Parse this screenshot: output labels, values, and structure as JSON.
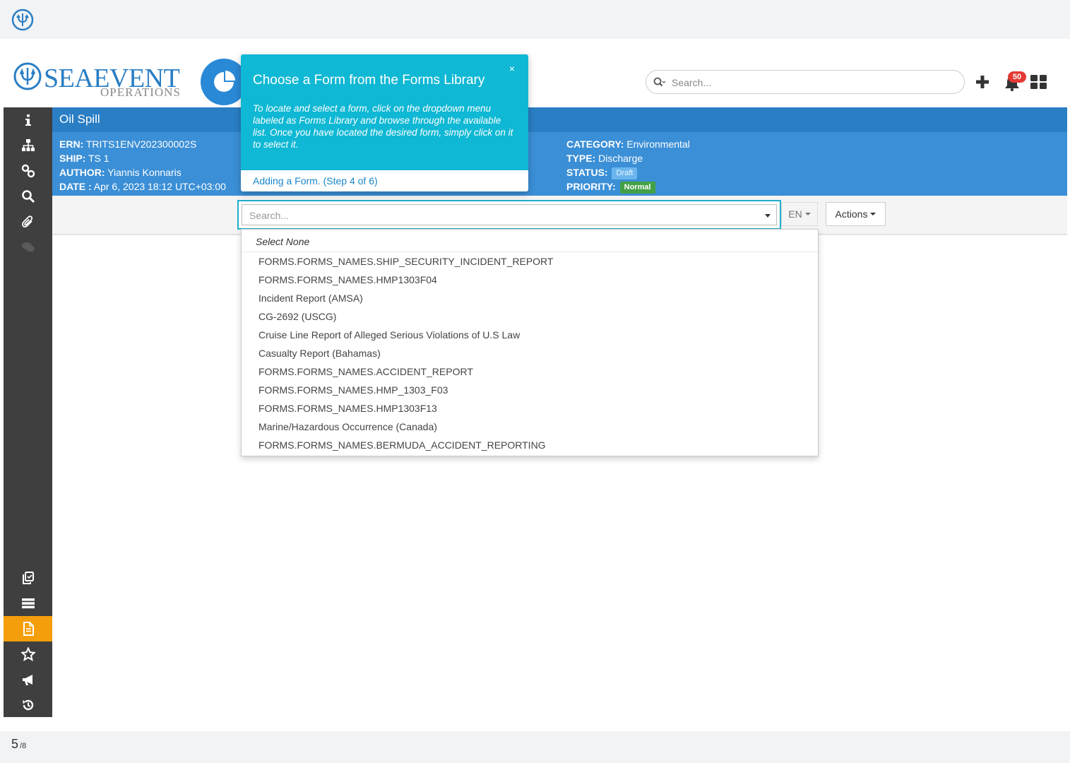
{
  "header": {
    "brand_name": "SEAEVENT",
    "brand_sub": "OPERATIONS",
    "search_placeholder": "Search...",
    "notifications_count": "50"
  },
  "incident": {
    "title": "Oil Spill",
    "ern_label": "ERN:",
    "ern": "TRITS1ENV202300002S",
    "ship_label": "SHIP:",
    "ship": "TS 1",
    "author_label": "AUTHOR:",
    "author": "Yiannis Konnaris",
    "date_label": "DATE :",
    "date": "Apr 6, 2023 18:12 UTC+03:00",
    "category_label": "CATEGORY:",
    "category": "Environmental",
    "type_label": "TYPE:",
    "type": "Discharge",
    "status_label": "STATUS:",
    "status": "Draft",
    "priority_label": "PRIORITY:",
    "priority": "Normal"
  },
  "toolbar": {
    "forms_search_placeholder": "Search...",
    "lang_label": "EN",
    "actions_label": "Actions"
  },
  "dropdown": {
    "select_none": "Select None",
    "options": [
      "FORMS.FORMS_NAMES.SHIP_SECURITY_INCIDENT_REPORT",
      "FORMS.FORMS_NAMES.HMP1303F04",
      "Incident Report (AMSA)",
      "CG-2692 (USCG)",
      "Cruise Line Report of Alleged Serious Violations of U.S Law",
      "Casualty Report (Bahamas)",
      "FORMS.FORMS_NAMES.ACCIDENT_REPORT",
      "FORMS.FORMS_NAMES.HMP_1303_F03",
      "FORMS.FORMS_NAMES.HMP1303F13",
      "Marine/Hazardous Occurrence (Canada)",
      "FORMS.FORMS_NAMES.BERMUDA_ACCIDENT_REPORTING"
    ]
  },
  "popover": {
    "title": "Choose a Form from the Forms Library",
    "close": "×",
    "text": "To locate and select a form, click on the dropdown menu labeled as Forms Library and browse through the available list. Once you have located the desired form, simply click on it to select it.",
    "step": "Adding a Form. (Step 4 of 6)"
  },
  "pagination": {
    "current": "5",
    "total": "/8"
  },
  "colors": {
    "brand_blue": "#2a7ec4",
    "panel_blue": "#3b8fd6",
    "tour_cyan": "#0fb8d4",
    "sidebar_dark": "#3f3f3f",
    "active_orange": "#f59e0b",
    "badge_red": "#e53935",
    "priority_green": "#43a047"
  },
  "sidebar_icons": [
    "info-icon",
    "sitemap-icon",
    "link-icon",
    "search-icon",
    "paperclip-icon",
    "comments-icon",
    "copy-icon",
    "list-icon",
    "form-icon",
    "star-icon",
    "bullhorn-icon",
    "history-icon"
  ]
}
